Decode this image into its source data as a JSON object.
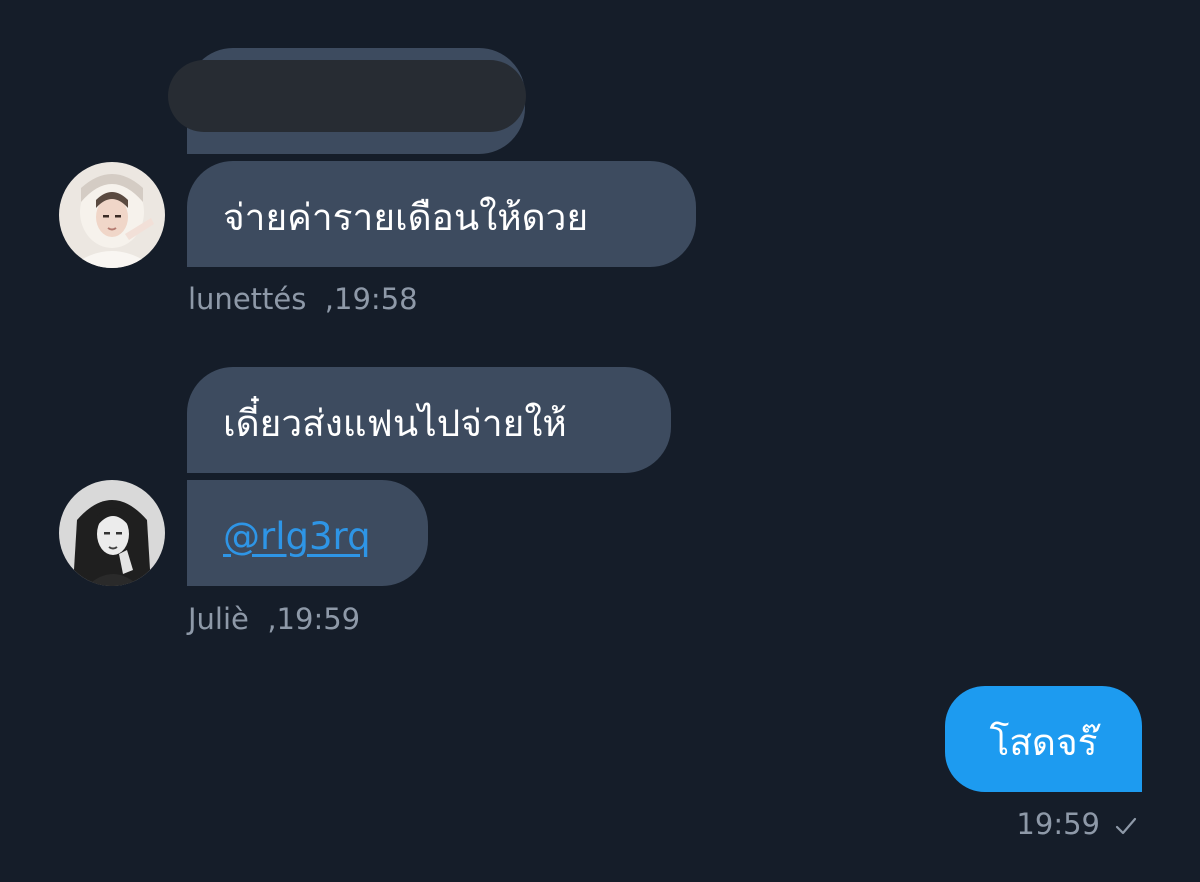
{
  "messages": [
    {
      "sender": "lunettés",
      "time": "19:58",
      "text": "จ่ายค่ารายเดือนให้ดวย"
    },
    {
      "sender": "Juliè",
      "time": "19:59",
      "text": "เดี๋ยวส่งแฟนไปจ่ายให้",
      "mention": "@rlg3rq"
    },
    {
      "sender": "me",
      "time": "19:59",
      "text": "โสดจร๊",
      "status": "sent-check-icon"
    }
  ],
  "colors": {
    "background": "#151d29",
    "received_bubble": "#3d4b5f",
    "sent_bubble": "#1d9bf0",
    "link": "#2e95e6",
    "meta_text": "#8e99a8",
    "redaction": "#272c33"
  }
}
